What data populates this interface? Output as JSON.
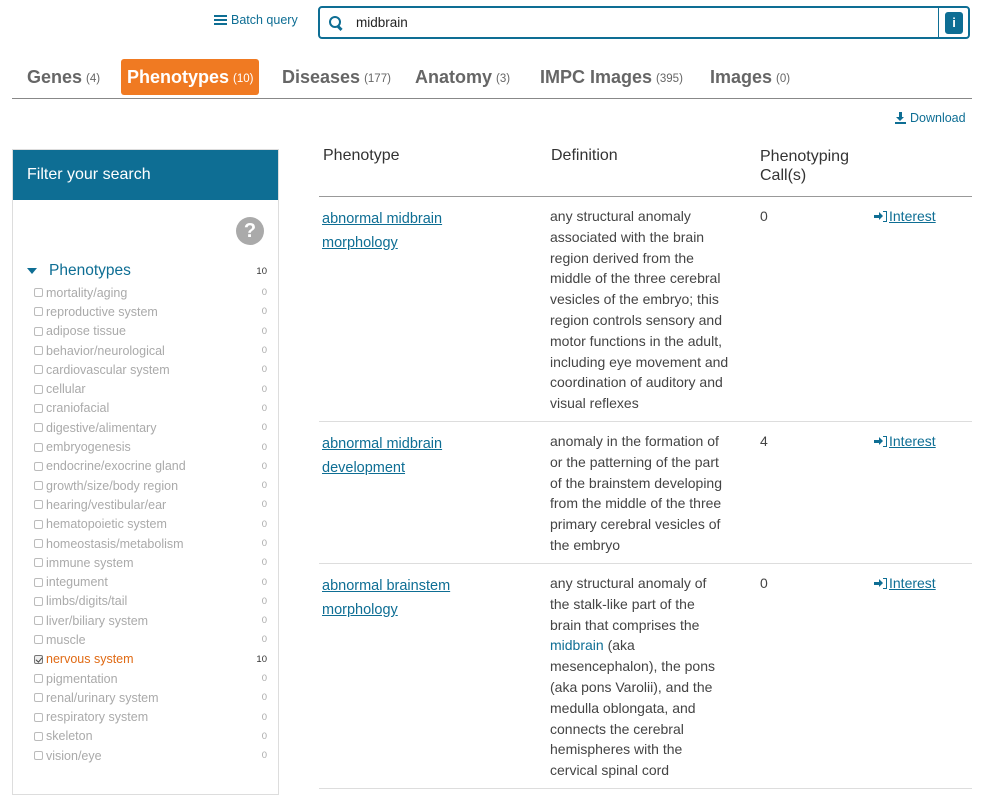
{
  "header": {
    "batch_query": "Batch query",
    "search_value": "midbrain",
    "info_label": "i"
  },
  "tabs": [
    {
      "label": "Genes",
      "count": "(4)"
    },
    {
      "label": "Phenotypes",
      "count": "(10)"
    },
    {
      "label": "Diseases",
      "count": "(177)"
    },
    {
      "label": "Anatomy",
      "count": "(3)"
    },
    {
      "label": "IMPC Images",
      "count": "(395)"
    },
    {
      "label": "Images",
      "count": "(0)"
    }
  ],
  "active_tab": "Phenotypes",
  "download": "Download",
  "sidebar": {
    "title": "Filter your search",
    "help": "?",
    "group": {
      "label": "Phenotypes",
      "count": "10"
    },
    "facets": [
      {
        "label": "mortality/aging",
        "count": "0"
      },
      {
        "label": "reproductive system",
        "count": "0"
      },
      {
        "label": "adipose tissue",
        "count": "0"
      },
      {
        "label": "behavior/neurological",
        "count": "0"
      },
      {
        "label": "cardiovascular system",
        "count": "0"
      },
      {
        "label": "cellular",
        "count": "0"
      },
      {
        "label": "craniofacial",
        "count": "0"
      },
      {
        "label": "digestive/alimentary",
        "count": "0"
      },
      {
        "label": "embryogenesis",
        "count": "0"
      },
      {
        "label": "endocrine/exocrine gland",
        "count": "0"
      },
      {
        "label": "growth/size/body region",
        "count": "0"
      },
      {
        "label": "hearing/vestibular/ear",
        "count": "0"
      },
      {
        "label": "hematopoietic system",
        "count": "0"
      },
      {
        "label": "homeostasis/metabolism",
        "count": "0"
      },
      {
        "label": "immune system",
        "count": "0"
      },
      {
        "label": "integument",
        "count": "0"
      },
      {
        "label": "limbs/digits/tail",
        "count": "0"
      },
      {
        "label": "liver/biliary system",
        "count": "0"
      },
      {
        "label": "muscle",
        "count": "0"
      },
      {
        "label": "nervous system",
        "count": "10",
        "checked": true
      },
      {
        "label": "pigmentation",
        "count": "0"
      },
      {
        "label": "renal/urinary system",
        "count": "0"
      },
      {
        "label": "respiratory system",
        "count": "0"
      },
      {
        "label": "skeleton",
        "count": "0"
      },
      {
        "label": "vision/eye",
        "count": "0"
      }
    ]
  },
  "table": {
    "headers": {
      "phenotype": "Phenotype",
      "definition": "Definition",
      "calls_line1": "Phenotyping",
      "calls_line2": "Call(s)"
    },
    "rows": [
      {
        "name_l1": "abnormal midbrain",
        "name_l2": "morphology",
        "definition": [
          "any structural anomaly",
          "associated with the brain",
          "region derived from the",
          "middle of the three cerebral",
          "vesicles of the embryo; this",
          "region controls sensory and",
          "motor functions in the adult,",
          "including eye movement and",
          "coordination of auditory and",
          "visual reflexes"
        ],
        "calls": "0",
        "interest": "Interest"
      },
      {
        "name_l1": "abnormal midbrain",
        "name_l2": "development",
        "definition": [
          "anomaly in the formation of",
          "or the patterning of the part",
          "of the brainstem developing",
          "from the middle of the three",
          "primary cerebral vesicles of",
          "the embryo"
        ],
        "calls": "4",
        "interest": "Interest"
      },
      {
        "name_l1": "abnormal brainstem",
        "name_l2": "morphology",
        "definition_a": [
          "any structural anomaly of",
          "the stalk-like part of the",
          "brain that comprises the"
        ],
        "definition_hl": "midbrain",
        "definition_b": [
          " (aka",
          "mesencephalon), the pons",
          "(aka pons Varolii), and the",
          "medulla oblongata, and",
          "connects the cerebral",
          "hemispheres with the",
          "cervical spinal cord"
        ],
        "calls": "0",
        "interest": "Interest"
      }
    ]
  }
}
